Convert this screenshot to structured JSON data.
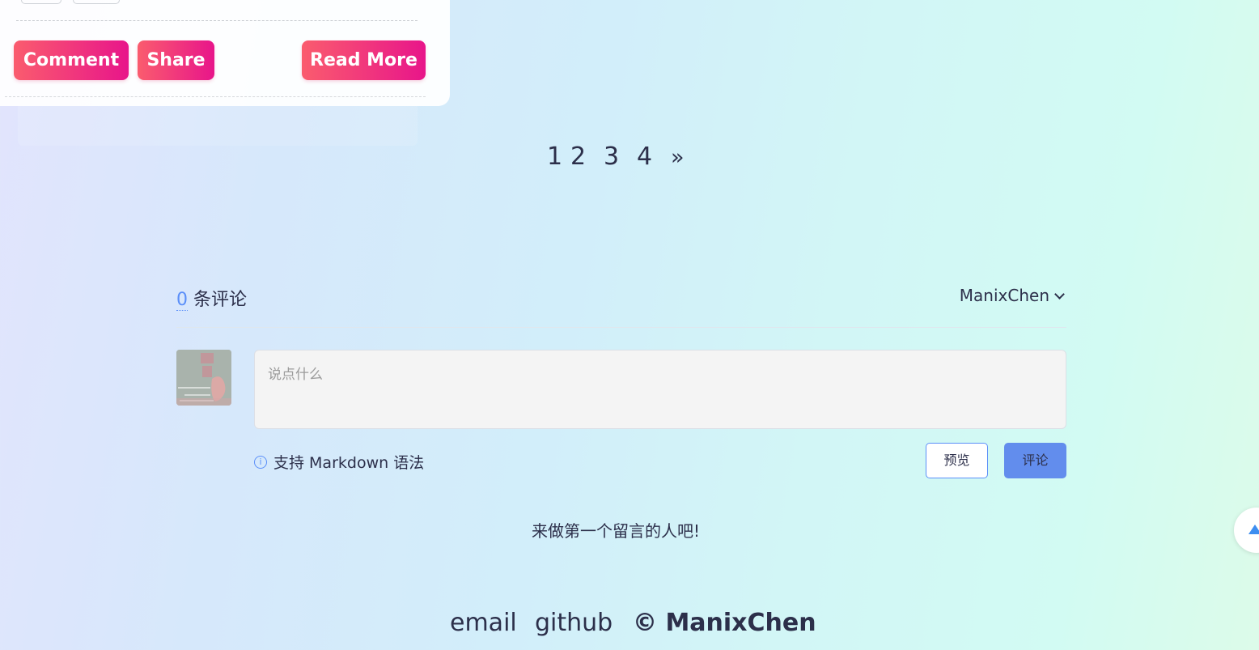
{
  "post_card": {
    "comment_label": "Comment",
    "share_label": "Share",
    "read_more_label": "Read More"
  },
  "pagination": {
    "pages": [
      "1",
      "2",
      "3",
      "4"
    ],
    "next_label": "»"
  },
  "comments": {
    "count": "0",
    "count_suffix": " 条评论",
    "user_name": "ManixChen",
    "placeholder": "说点什么",
    "markdown_hint": "支持 Markdown 语法",
    "preview_label": "预览",
    "submit_label": "评论",
    "empty_message": "来做第一个留言的人吧!"
  },
  "footer": {
    "email_label": "email",
    "github_label": "github",
    "copyright": "© ManixChen"
  },
  "colors": {
    "accent_pink_start": "#fa5c6e",
    "accent_pink_end": "#e8158a",
    "accent_blue": "#5b8ff9",
    "submit_blue": "#628ded",
    "text": "#2c2f4a"
  },
  "icons": {
    "markdown_hint": "info-icon",
    "user_dropdown": "chevron-down-icon",
    "back_to_top": "arrow-up-icon"
  }
}
